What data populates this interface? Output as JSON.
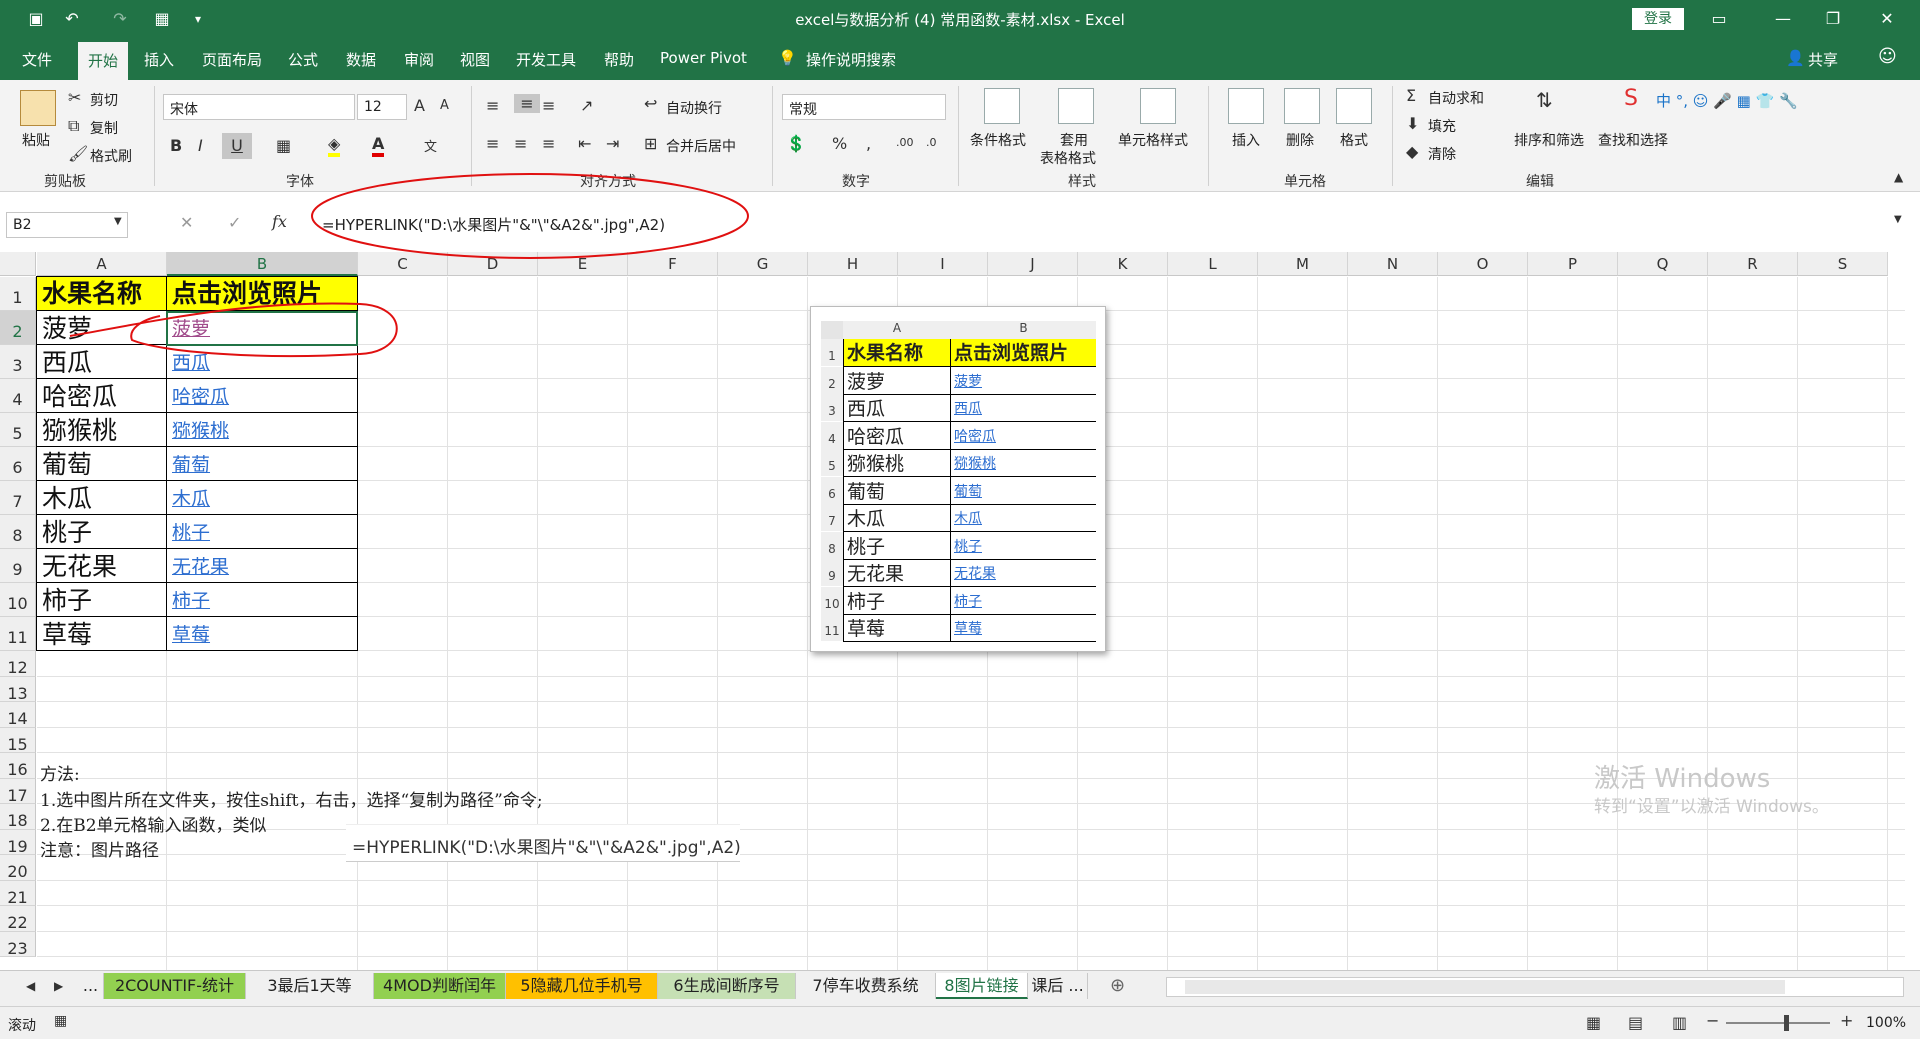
{
  "app": {
    "title": "excel与数据分析 (4) 常用函数-素材.xlsx  -  Excel",
    "login": "登录",
    "share": "共享",
    "tell_me": "操作说明搜索"
  },
  "menu_tabs": [
    "文件",
    "开始",
    "插入",
    "页面布局",
    "公式",
    "数据",
    "审阅",
    "视图",
    "开发工具",
    "帮助",
    "Power Pivot"
  ],
  "ribbon": {
    "clipboard": {
      "paste": "粘贴",
      "cut": "剪切",
      "copy": "复制",
      "format_painter": "格式刷",
      "label": "剪贴板"
    },
    "font": {
      "name": "宋体",
      "size": "12",
      "label": "字体",
      "bold": "B",
      "italic": "I",
      "underline": "U"
    },
    "alignment": {
      "wrap": "自动换行",
      "merge": "合并后居中",
      "label": "对齐方式"
    },
    "number": {
      "format": "常规",
      "label": "数字"
    },
    "styles": {
      "conditional": "条件格式",
      "table1": "套用",
      "table2": "表格格式",
      "cell_styles": "单元格样式",
      "label": "样式"
    },
    "cells": {
      "insert": "插入",
      "delete": "删除",
      "format": "格式",
      "label": "单元格"
    },
    "editing": {
      "autosum": "自动求和",
      "fill": "填充",
      "clear": "清除",
      "sort": "排序和筛选",
      "find": "查找和选择",
      "label": "编辑"
    }
  },
  "formula_bar": {
    "name_box": "B2",
    "formula": "=HYPERLINK(\"D:\\水果图片\"&\"\\\"&A2&\".jpg\",A2)"
  },
  "columns": [
    "A",
    "B",
    "C",
    "D",
    "E",
    "F",
    "G",
    "H",
    "I",
    "J",
    "K",
    "L",
    "M",
    "N",
    "O",
    "P",
    "Q",
    "R",
    "S"
  ],
  "rows": [
    "1",
    "2",
    "3",
    "4",
    "5",
    "6",
    "7",
    "8",
    "9",
    "10",
    "11",
    "12",
    "13",
    "14",
    "15",
    "16",
    "17",
    "18",
    "19",
    "20",
    "21",
    "22",
    "23"
  ],
  "table": {
    "header_a": "水果名称",
    "header_b": "点击浏览照片",
    "fruits": [
      "菠萝",
      "西瓜",
      "哈密瓜",
      "猕猴桃",
      "葡萄",
      "木瓜",
      "桃子",
      "无花果",
      "柿子",
      "草莓"
    ]
  },
  "notes": {
    "r16": "方法:",
    "r17": "1.选中图片所在文件夹，按住shift，右击，选择“复制为路径”命令;",
    "r18": "2.在B2单元格输入函数，类似",
    "r19": "注意：图片路径",
    "formula_popup": "=HYPERLINK(\"D:\\水果图片\"&\"\\\"&A2&\".jpg\",A2)"
  },
  "picture": {
    "col_a": "A",
    "col_b": "B",
    "rows": [
      "1",
      "2",
      "3",
      "4",
      "5",
      "6",
      "7",
      "8",
      "9",
      "10",
      "11"
    ]
  },
  "sheet_tabs": [
    "...",
    "2COUNTIF-统计",
    "3最后1天等",
    "4MOD判断闰年",
    "5隐藏几位手机号",
    "6生成间断序号",
    "7停车收费系统",
    "8图片链接",
    "课后 ..."
  ],
  "sheet_tab_colors": [
    "none",
    "#92d050",
    "none",
    "#92d050",
    "#ffc000",
    "#c6e0b4",
    "none",
    "active",
    "none"
  ],
  "watermark": {
    "line1": "激活 Windows",
    "line2": "转到“设置”以激活 Windows。"
  },
  "status": {
    "mode": "滚动",
    "zoom": "100%"
  }
}
